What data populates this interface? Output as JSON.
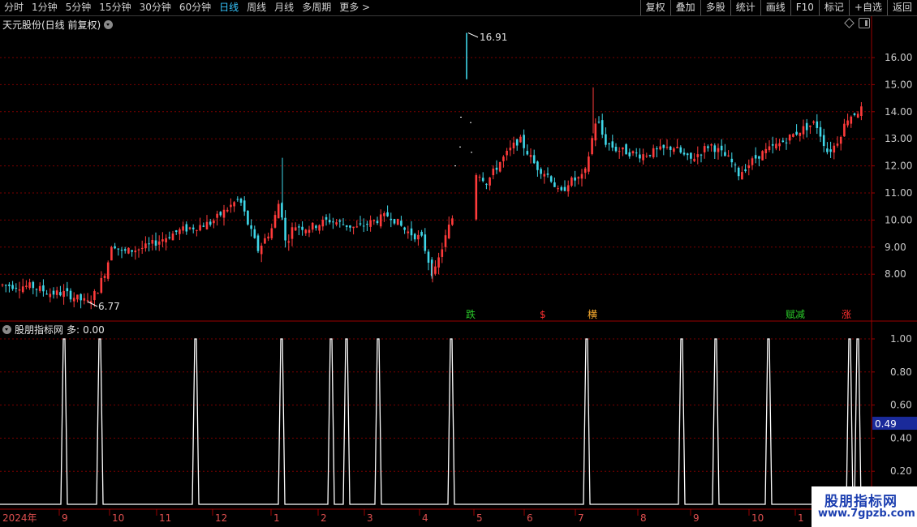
{
  "toolbar": {
    "periods": [
      "分时",
      "1分钟",
      "5分钟",
      "15分钟",
      "30分钟",
      "60分钟",
      "日线",
      "周线",
      "月线",
      "多周期",
      "更多 >"
    ],
    "active_period": "日线",
    "buttons": [
      "复权",
      "叠加",
      "多股",
      "统计",
      "画线",
      "F10",
      "标记",
      "+自选",
      "返回"
    ]
  },
  "stock": {
    "title": "天元股份(日线 前复权)"
  },
  "indicator": {
    "name": "股朋指标网",
    "label": "多:",
    "value": "0.00",
    "cursor_value": "0.49"
  },
  "price_axis": {
    "ticks": [
      "16.00",
      "15.00",
      "14.00",
      "13.00",
      "12.00",
      "11.00",
      "10.00",
      "9.00",
      "8.00"
    ]
  },
  "ind_axis": {
    "ticks": [
      "1.00",
      "0.80",
      "0.60",
      "0.40",
      "0.20"
    ]
  },
  "annotations": {
    "high": "16.91",
    "low": "6.77"
  },
  "signals": [
    {
      "text": "跌",
      "color": "#29c829"
    },
    {
      "text": "$",
      "color": "#ff3030"
    },
    {
      "text": "横",
      "color": "#ffb030"
    },
    {
      "text": "赋减",
      "color": "#29c829"
    },
    {
      "text": "涨",
      "color": "#ff3030"
    }
  ],
  "time_axis": {
    "year_label": "2024年",
    "months": [
      "9",
      "10",
      "11",
      "12",
      "1",
      "2",
      "3",
      "4",
      "5",
      "6",
      "7",
      "8",
      "9",
      "10",
      "1"
    ]
  },
  "watermark": {
    "line1": "股朋指标网",
    "line2": "www.7gpzb.com"
  },
  "colors": {
    "up": "#ff3b3b",
    "down": "#3fd6e8",
    "grid": "#7a0000",
    "axis": "#9a0000",
    "signal_line": "#ffffff",
    "cursor_bg": "#1a2a9a"
  }
}
